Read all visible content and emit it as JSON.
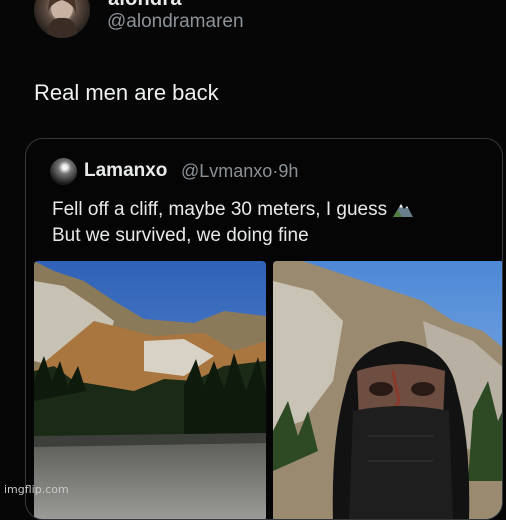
{
  "post": {
    "display_name": "alondra",
    "handle": "@alondramaren",
    "text": "Real men are back"
  },
  "quote": {
    "name": "Lamanxo",
    "handle": "@Lvmanxo",
    "separator": "·",
    "time": "9h",
    "line1": "Fell off a cliff, maybe 30 meters, I guess",
    "line2": "But we survived, we doing fine",
    "emoji_icon": "snow-capped-mountain-icon",
    "images": [
      "cliff-valley-photo",
      "balaclava-selfie-photo"
    ]
  },
  "watermark": "imgflip.com"
}
